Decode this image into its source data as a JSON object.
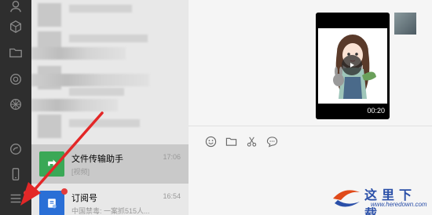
{
  "conversations": [
    {
      "name": "文件传输助手",
      "time": "17:06",
      "preview": "[视频]",
      "selected": true,
      "avatar_color": "#3aa856"
    },
    {
      "name": "订阅号",
      "time": "16:54",
      "preview": "中国禁毒: 一案抓515人...",
      "selected": false,
      "avatar_color": "#2a6fd6"
    }
  ],
  "chat": {
    "video_duration": "00:20"
  },
  "toolbar": {
    "icons": [
      "emoji-icon",
      "folder-icon",
      "scissors-icon",
      "chat-bubble-icon"
    ]
  },
  "watermark": {
    "text": "这里下载",
    "url": "www.heredown.com"
  },
  "colors": {
    "rail_bg": "#2e2e2e",
    "list_bg": "#e8e8e8",
    "selected_bg": "#c9c9c9",
    "arrow": "#e32727",
    "badge": "#e33b3b"
  }
}
